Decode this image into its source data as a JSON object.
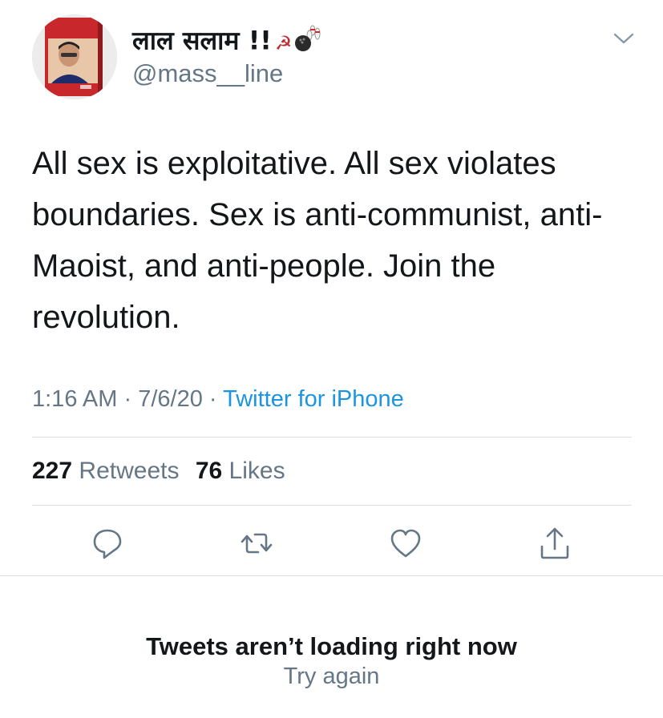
{
  "tweet": {
    "display_name": "लाल सलाम !!",
    "display_name_emojis": [
      "hammer-and-sickle-icon",
      "bowling-icon"
    ],
    "handle": "@mass__line",
    "text": "All sex is exploitative. All sex violates boundaries. Sex is anti-communist, anti-Maoist, and anti-people. Join the revolution.",
    "time": "1:16 AM",
    "date": "7/6/20",
    "source": "Twitter for iPhone",
    "separator": "·"
  },
  "stats": {
    "retweets_count": "227",
    "retweets_label": "Retweets",
    "likes_count": "76",
    "likes_label": "Likes"
  },
  "actions": [
    "reply-icon",
    "retweet-icon",
    "like-icon",
    "share-icon"
  ],
  "error": {
    "title": "Tweets aren’t loading right now",
    "retry": "Try again"
  },
  "colors": {
    "text": "#14171a",
    "secondary": "#657786",
    "link": "#1b95e0",
    "divider": "#d8dde2"
  }
}
